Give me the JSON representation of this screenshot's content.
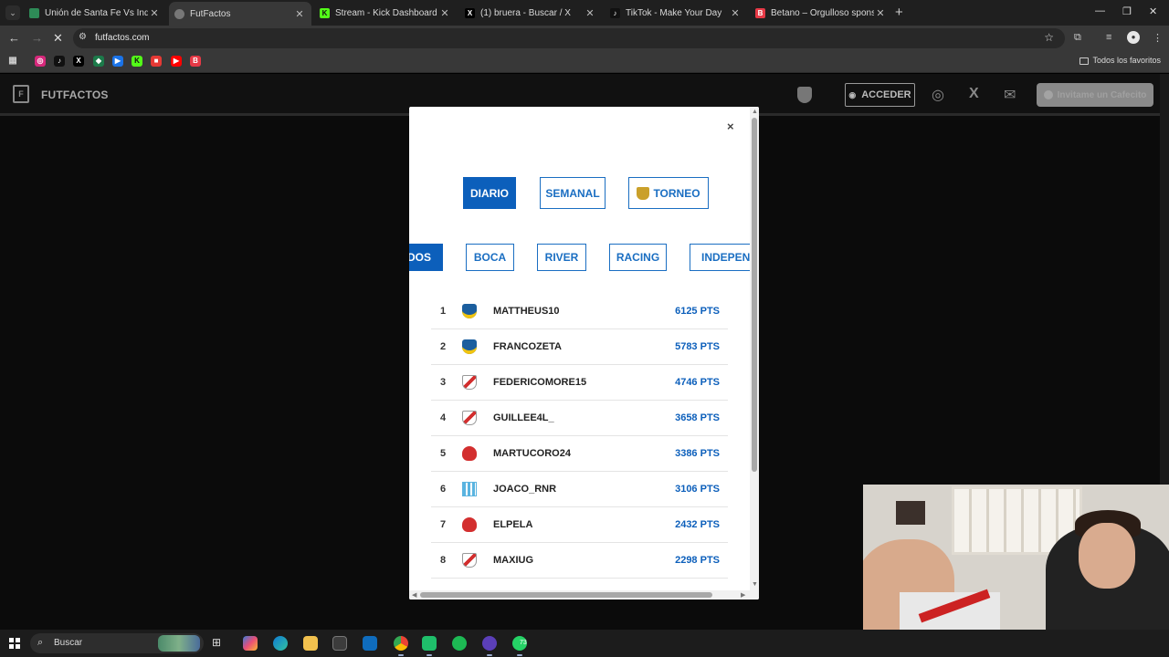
{
  "browser": {
    "tabs": [
      {
        "title": "Unión de Santa Fe Vs Independ",
        "color": "#2e8b57",
        "active": false
      },
      {
        "title": "FutFactos",
        "color": "#888888",
        "active": true
      },
      {
        "title": "Stream - Kick Dashboard",
        "color": "#53fc18",
        "active": false
      },
      {
        "title": "(1) bruera - Buscar / X",
        "color": "#000000",
        "active": false
      },
      {
        "title": "TikTok - Make Your Day",
        "color": "#111111",
        "active": false
      },
      {
        "title": "Betano – Orgulloso sponsor de",
        "color": "#e63946",
        "active": false
      }
    ],
    "url": "futfactos.com",
    "all_favorites_label": "Todos los favoritos"
  },
  "site": {
    "logo_text": "FUTFACTOS",
    "acceder_label": "ACCEDER",
    "cafecito_label": "Invitame un Cafecito"
  },
  "modal": {
    "close_glyph": "×",
    "periods": [
      {
        "label": "DIARIO",
        "active": true
      },
      {
        "label": "SEMANAL",
        "active": false
      },
      {
        "label": "TORNEO",
        "active": false
      }
    ],
    "teams": [
      {
        "label": "ODOS",
        "active": true
      },
      {
        "label": "BOCA",
        "active": false
      },
      {
        "label": "RIVER",
        "active": false
      },
      {
        "label": "RACING",
        "active": false
      },
      {
        "label": "INDEPENDII",
        "active": false
      }
    ],
    "ranking": [
      {
        "rank": "1",
        "user": "MATTHEUS10",
        "points": "6125 PTS",
        "team": "boca"
      },
      {
        "rank": "2",
        "user": "FRANCOZETA",
        "points": "5783 PTS",
        "team": "boca"
      },
      {
        "rank": "3",
        "user": "FEDERICOMORE15",
        "points": "4746 PTS",
        "team": "river"
      },
      {
        "rank": "4",
        "user": "GUILLEE4L_",
        "points": "3658 PTS",
        "team": "river"
      },
      {
        "rank": "5",
        "user": "MARTUCORO24",
        "points": "3386 PTS",
        "team": "independiente"
      },
      {
        "rank": "6",
        "user": "JOACO_RNR",
        "points": "3106 PTS",
        "team": "racing"
      },
      {
        "rank": "7",
        "user": "ELPELA",
        "points": "2432 PTS",
        "team": "independiente"
      },
      {
        "rank": "8",
        "user": "MAXIUG",
        "points": "2298 PTS",
        "team": "river"
      }
    ]
  },
  "taskbar": {
    "search_label": "Buscar",
    "whatsapp_badge": "73"
  },
  "colors": {
    "accent_blue": "#0c5fbb",
    "boca": "#1b5e9e",
    "river": "#d32f2f",
    "racing": "#5ab4e0",
    "independiente": "#d32f2f"
  }
}
